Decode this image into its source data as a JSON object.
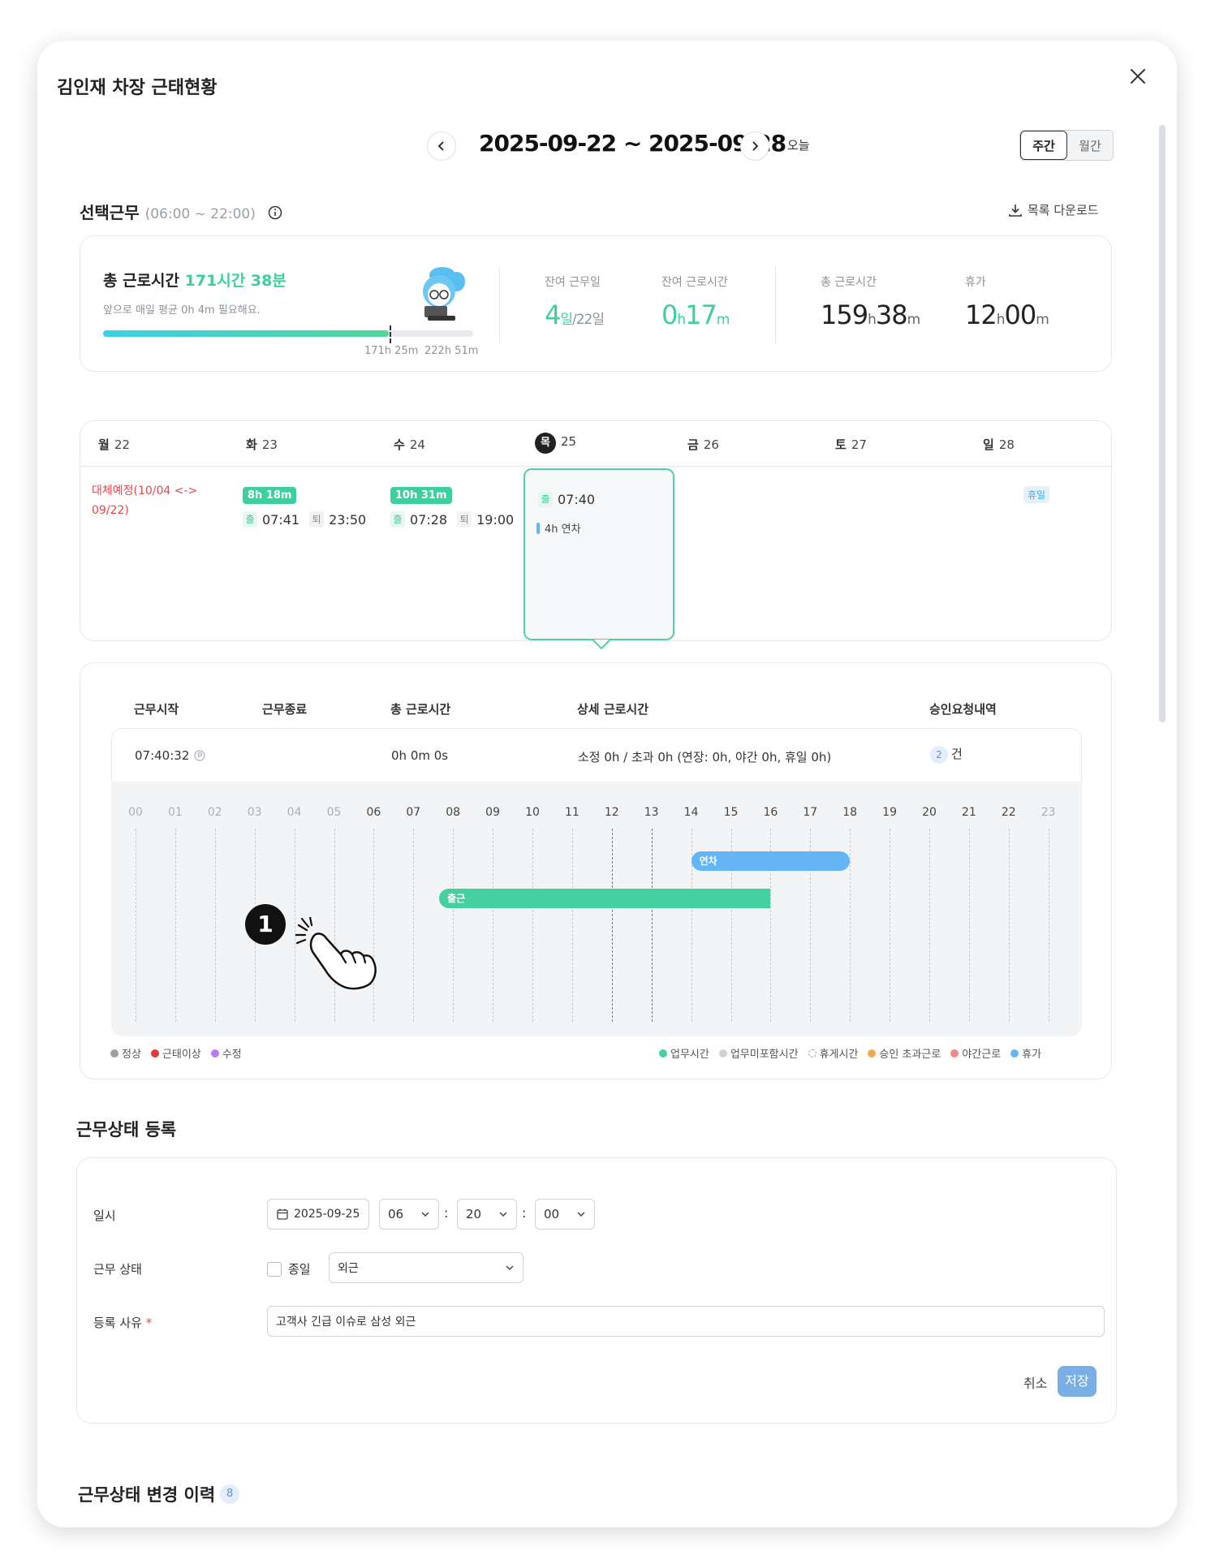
{
  "modal": {
    "title": "김인재 차장 근태현황"
  },
  "nav": {
    "date_range": "2025-09-22 ~ 2025-09-28",
    "today_label": "오늘",
    "view_weekly": "주간",
    "view_monthly": "월간"
  },
  "section": {
    "title": "선택근무",
    "hours": "(06:00 ~ 22:00)",
    "download_label": "목록 다운로드"
  },
  "summary": {
    "total_label": "총 근로시간",
    "total_value": "171시간 38분",
    "need_text": "앞으로 매일 평균 0h 4m 필요해요.",
    "progress_fraction": 0.772,
    "bar_label_current": "171h 25m",
    "bar_label_max": "222h 51m",
    "remaining_days_label": "잔여 근무일",
    "remaining_days_value": "4",
    "remaining_days_unit": "일",
    "remaining_days_total": "/22일",
    "remaining_hours_label": "잔여 근로시간",
    "remaining_hours_h": "0",
    "remaining_hours_m": "17",
    "total_hours_label": "총 근로시간",
    "total_hours_h": "159",
    "total_hours_m": "38",
    "leave_label": "휴가",
    "leave_h": "12",
    "leave_m": "00",
    "unit_h": "h",
    "unit_m": "m"
  },
  "week": {
    "days": [
      {
        "dow": "월",
        "num": "22"
      },
      {
        "dow": "화",
        "num": "23"
      },
      {
        "dow": "수",
        "num": "24"
      },
      {
        "dow": "목",
        "num": "25"
      },
      {
        "dow": "금",
        "num": "26"
      },
      {
        "dow": "토",
        "num": "27"
      },
      {
        "dow": "일",
        "num": "28"
      }
    ],
    "mon_note": "대체예정(10/04 <-> 09/22)",
    "tue": {
      "badge": "8h 18m",
      "in_label": "출",
      "in_time": "07:41",
      "out_label": "퇴",
      "out_time": "23:50"
    },
    "wed": {
      "badge": "10h 31m",
      "in_label": "출",
      "in_time": "07:28",
      "out_label": "퇴",
      "out_time": "19:00"
    },
    "thu": {
      "in_label": "출",
      "in_time": "07:40",
      "leave_text": "4h 연차"
    },
    "sun_badge": "휴일"
  },
  "detail": {
    "headers": {
      "start": "근무시작",
      "end": "근무종료",
      "total": "총 근로시간",
      "breakdown": "상세 근로시간",
      "approval": "승인요청내역"
    },
    "start_value": "07:40:32",
    "start_icon": "p-circle-icon",
    "total_value": "0h 0m 0s",
    "breakdown_value": "소정 0h / 초과 0h (연장: 0h, 야간 0h, 휴일 0h)",
    "approval_count": "2",
    "approval_unit": "건",
    "hours": [
      "00",
      "01",
      "02",
      "03",
      "04",
      "05",
      "06",
      "07",
      "08",
      "09",
      "10",
      "11",
      "12",
      "13",
      "14",
      "15",
      "16",
      "17",
      "18",
      "19",
      "20",
      "21",
      "22",
      "23"
    ],
    "bars": [
      {
        "label": "연차",
        "start": 14,
        "end": 18,
        "color": "#64b5f6"
      },
      {
        "label": "출근",
        "start": 7.65,
        "end": 16,
        "color": "#45d0a2"
      }
    ]
  },
  "legend": {
    "left": [
      {
        "label": "정상",
        "color": "#9e9e9e"
      },
      {
        "label": "근태이상",
        "color": "#e53935"
      },
      {
        "label": "수정",
        "color": "#b57cf2"
      }
    ],
    "right": [
      {
        "label": "업무시간",
        "color": "#45d0a2"
      },
      {
        "label": "업무미포함시간",
        "color": "#cfd3d8"
      },
      {
        "label": "휴게시간",
        "color": "dashed"
      },
      {
        "label": "승인 초과근로",
        "color": "#f5a94f"
      },
      {
        "label": "야간근로",
        "color": "#f28a8a"
      },
      {
        "label": "휴가",
        "color": "#64b5f6"
      }
    ]
  },
  "register": {
    "title": "근무상태 등록",
    "datetime_label": "일시",
    "date_value": "2025-09-25",
    "hour_value": "06",
    "minute_value": "20",
    "second_value": "00",
    "status_label": "근무 상태",
    "allday_label": "종일",
    "status_value": "외근",
    "reason_label": "등록 사유",
    "reason_required": "*",
    "reason_value": "고객사 긴급 이슈로 삼성 외근",
    "cancel_label": "취소",
    "save_label": "저장"
  },
  "history": {
    "title": "근무상태 변경 이력",
    "count": "8"
  },
  "annotation": {
    "step": "1"
  }
}
